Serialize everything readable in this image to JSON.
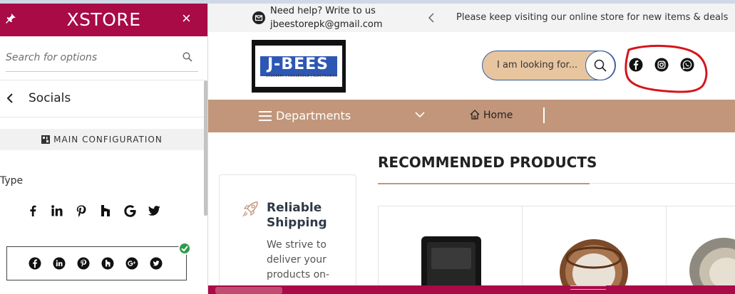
{
  "panel": {
    "brand": "XSTORE",
    "search_placeholder": "Search for options",
    "section_title": "Socials",
    "main_config_label": "MAIN CONFIGURATION",
    "type_label": "Type",
    "type_icons": [
      "facebook-f",
      "linkedin-in",
      "pinterest",
      "houzz",
      "google",
      "twitter"
    ],
    "option_icons": [
      "facebook-circle",
      "linkedin-circle",
      "pinterest-circle",
      "houzz-circle",
      "google-plus-circle",
      "twitter-circle"
    ],
    "colors": {
      "header": "#a80b46",
      "check": "#2e9b4a"
    }
  },
  "store": {
    "help_line1": "Need help? Write to us",
    "help_line2": "jbeestorepk@gmail.com",
    "promo": "Please keep visiting our online store for new items & deals",
    "logo_text": "J-BEES",
    "logo_sub": "CROCKERY | HOUSEHOLD | ELECTRONICS",
    "search_placeholder": "I am looking for...",
    "socials": [
      "facebook-icon",
      "instagram-icon",
      "whatsapp-icon"
    ],
    "nav": {
      "departments": "Departments",
      "home": "Home"
    },
    "section_title": "RECOMMENDED PRODUCTS",
    "shipping": {
      "title": "Reliable Shipping",
      "text": "We strive to deliver your products on-"
    },
    "colors": {
      "nav": "#c2967a",
      "search_bg": "#e7c59f",
      "annotation": "#d4141c"
    }
  }
}
